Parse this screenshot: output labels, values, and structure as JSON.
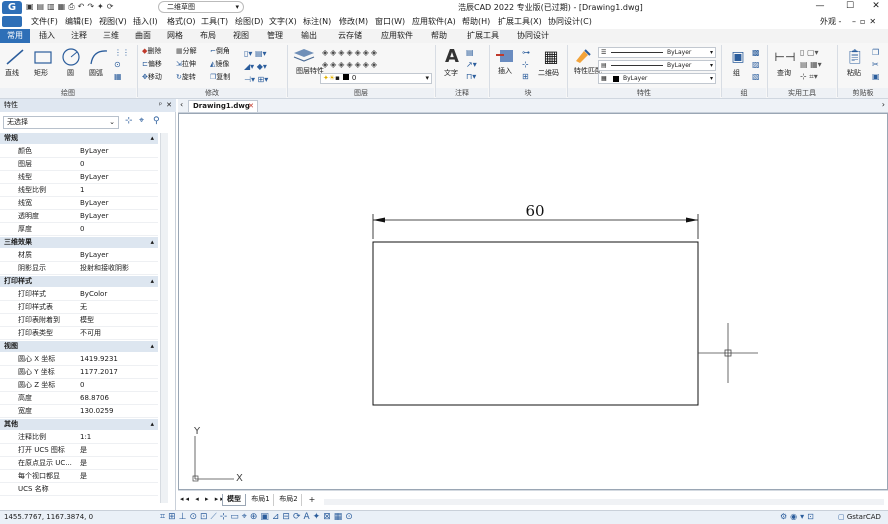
{
  "title": "浩辰CAD 2022 专业版(已过期) - [Drawing1.dwg]",
  "workspace": "二维草图",
  "window_controls": [
    "—",
    "☐",
    "✕"
  ],
  "menus": [
    "文件(F)",
    "编辑(E)",
    "视图(V)",
    "插入(I)",
    "格式(O)",
    "工具(T)",
    "绘图(D)",
    "文字(X)",
    "标注(N)",
    "修改(M)",
    "窗口(W)",
    "应用软件(A)",
    "帮助(H)",
    "扩展工具(X)",
    "协同设计(C)"
  ],
  "menu_right": "外观 -",
  "tabs": [
    "常用",
    "插入",
    "注释",
    "三维",
    "曲面",
    "网格",
    "布局",
    "视图",
    "管理",
    "输出",
    "云存储",
    "应用软件",
    "帮助",
    "扩展工具",
    "协同设计"
  ],
  "ribbon": {
    "draw": {
      "line": "直线",
      "rect": "矩形",
      "circle": "圆",
      "arc": "圆弧",
      "label": "绘图"
    },
    "modify": {
      "r1": [
        "删除",
        "分解",
        "偏移",
        "拉伸",
        "移动",
        "旋转"
      ],
      "r2": [
        "倒角",
        "镜像",
        "复制"
      ],
      "label": "修改"
    },
    "layer": {
      "btn": "图层特性",
      "current": "0",
      "label": "图层"
    },
    "annotation": {
      "text": "文字",
      "label": "注释"
    },
    "block": {
      "insert": "插入",
      "qr": "二维码",
      "label": "块"
    },
    "properties": {
      "match": "特性匹配",
      "v1": "ByLayer",
      "v2": "ByLayer",
      "v3": "ByLayer",
      "label": "特性"
    },
    "group": {
      "btn": "组",
      "label": "组"
    },
    "utilities": {
      "btn": "查询",
      "label": "实用工具"
    },
    "clipboard": {
      "btn": "粘贴",
      "label": "剪贴板"
    }
  },
  "props": {
    "title": "特性",
    "select": "无选择",
    "sections": [
      {
        "name": "常规",
        "rows": [
          [
            "颜色",
            "ByLayer"
          ],
          [
            "图层",
            "0"
          ],
          [
            "线型",
            "ByLayer"
          ],
          [
            "线型比例",
            "1"
          ],
          [
            "线宽",
            "ByLayer"
          ],
          [
            "透明度",
            "ByLayer"
          ],
          [
            "厚度",
            "0"
          ]
        ]
      },
      {
        "name": "三维效果",
        "rows": [
          [
            "材质",
            "ByLayer"
          ],
          [
            "阴影显示",
            "投射和接收阴影"
          ]
        ]
      },
      {
        "name": "打印样式",
        "rows": [
          [
            "打印样式",
            "ByColor"
          ],
          [
            "打印样式表",
            "无"
          ],
          [
            "打印表附着到",
            "模型"
          ],
          [
            "打印表类型",
            "不可用"
          ]
        ]
      },
      {
        "name": "视图",
        "rows": [
          [
            "圆心 X 坐标",
            "1419.9231"
          ],
          [
            "圆心 Y 坐标",
            "1177.2017"
          ],
          [
            "圆心 Z 坐标",
            "0"
          ],
          [
            "高度",
            "68.8706"
          ],
          [
            "宽度",
            "130.0259"
          ]
        ]
      },
      {
        "name": "其他",
        "rows": [
          [
            "注释比例",
            "1:1"
          ],
          [
            "打开 UCS 图标",
            "是"
          ],
          [
            "在原点显示 UC...",
            "是"
          ],
          [
            "每个视口都显",
            "是"
          ],
          [
            "UCS 名称",
            ""
          ]
        ]
      }
    ]
  },
  "doc_tab": "Drawing1.dwg",
  "drawing": {
    "dimension": "60",
    "axis_x": "X",
    "axis_y": "Y"
  },
  "layout_tabs": [
    "模型",
    "布局1",
    "布局2",
    "+"
  ],
  "status": {
    "coords": "1455.7767, 1167.3874, 0",
    "app": "GstarCAD"
  }
}
